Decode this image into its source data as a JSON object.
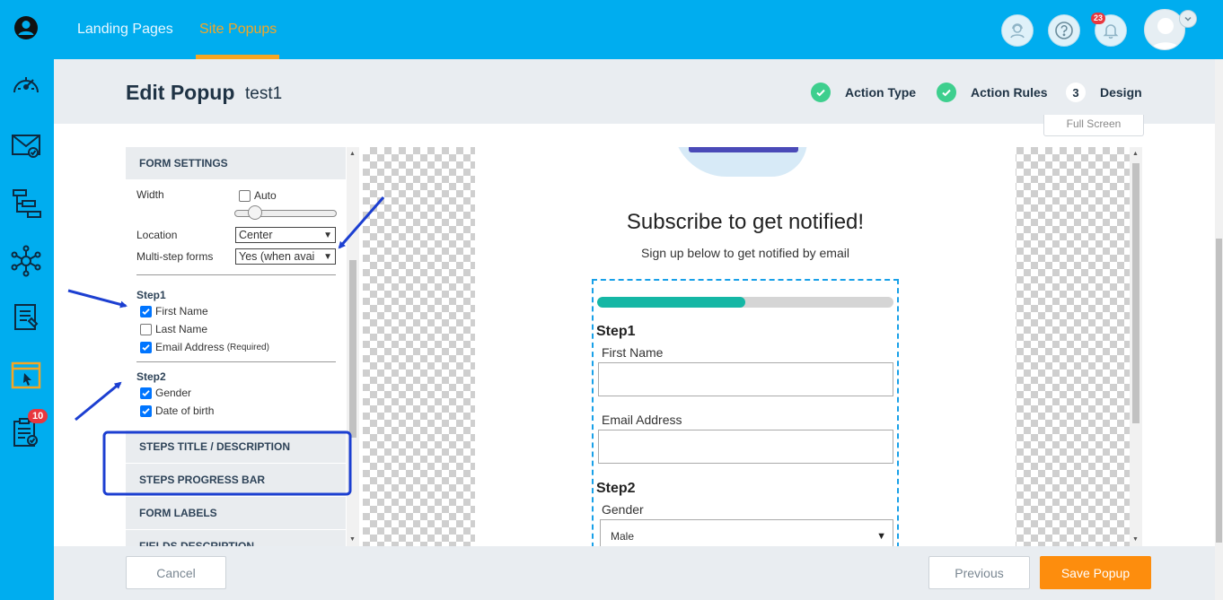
{
  "top_nav": {
    "landing_pages": "Landing Pages",
    "site_popups": "Site Popups"
  },
  "notifications": {
    "count": "23"
  },
  "sidebar": {
    "tasks_badge": "10"
  },
  "header": {
    "title": "Edit Popup",
    "popup_name": "test1",
    "steps": [
      {
        "label": "Action Type",
        "state": "done"
      },
      {
        "label": "Action Rules",
        "state": "done"
      },
      {
        "label": "Design",
        "number": "3",
        "state": "current"
      }
    ]
  },
  "toolbar": {
    "fullscreen": "Full Screen"
  },
  "form_settings": {
    "heading": "FORM SETTINGS",
    "width_label": "Width",
    "auto_label": "Auto",
    "auto_checked": false,
    "location_label": "Location",
    "location_value": "Center",
    "multistep_label": "Multi-step forms",
    "multistep_value": "Yes (when avai",
    "step1": {
      "title": "Step1",
      "fields": [
        {
          "label": "First Name",
          "checked": true,
          "note": ""
        },
        {
          "label": "Last Name",
          "checked": false,
          "note": ""
        },
        {
          "label": "Email Address",
          "checked": true,
          "note": "(Required)"
        }
      ]
    },
    "step2": {
      "title": "Step2",
      "fields": [
        {
          "label": "Gender",
          "checked": true
        },
        {
          "label": "Date of birth",
          "checked": true
        }
      ]
    }
  },
  "sections": {
    "steps_title": "STEPS TITLE / DESCRIPTION",
    "steps_progress": "STEPS PROGRESS BAR",
    "form_labels": "FORM LABELS",
    "fields_description": "FIELDS DESCRIPTION"
  },
  "preview": {
    "title": "Subscribe to get notified!",
    "subtitle": "Sign up below to get notified by email",
    "progress_fraction": 0.5,
    "step1_title": "Step1",
    "first_name_label": "First Name",
    "email_label": "Email Address",
    "step2_title": "Step2",
    "gender_label": "Gender",
    "gender_value": "Male"
  },
  "footer": {
    "cancel": "Cancel",
    "previous": "Previous",
    "save": "Save Popup"
  },
  "colors": {
    "brand_blue": "#00adef",
    "accent_orange": "#fd8d0d",
    "progress_teal": "#15b7a5",
    "success_green": "#3ecf8e",
    "annotation_blue": "#1c3fd1"
  }
}
